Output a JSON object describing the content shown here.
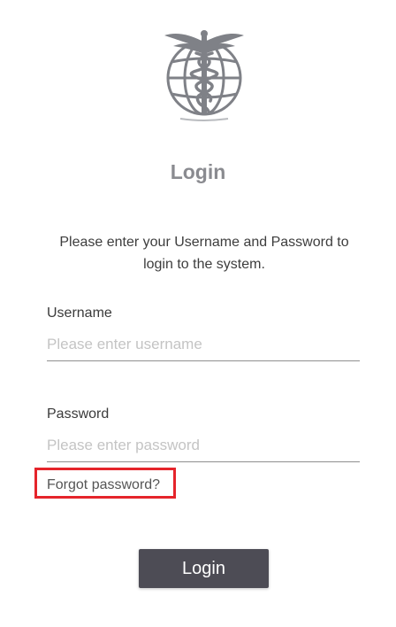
{
  "header": {
    "logo_icon": "caduceus-globe-icon",
    "title": "Login"
  },
  "instructions": "Please enter your Username and Password to login to the system.",
  "form": {
    "username": {
      "label": "Username",
      "value": "",
      "placeholder": "Please enter username"
    },
    "password": {
      "label": "Password",
      "value": "",
      "placeholder": "Please enter password"
    },
    "forgot_password": "Forgot password?",
    "submit_label": "Login"
  },
  "colors": {
    "button": "#4d4c55",
    "highlight": "#e5242b",
    "title": "#8a8b90",
    "logo": "#7f8187"
  }
}
